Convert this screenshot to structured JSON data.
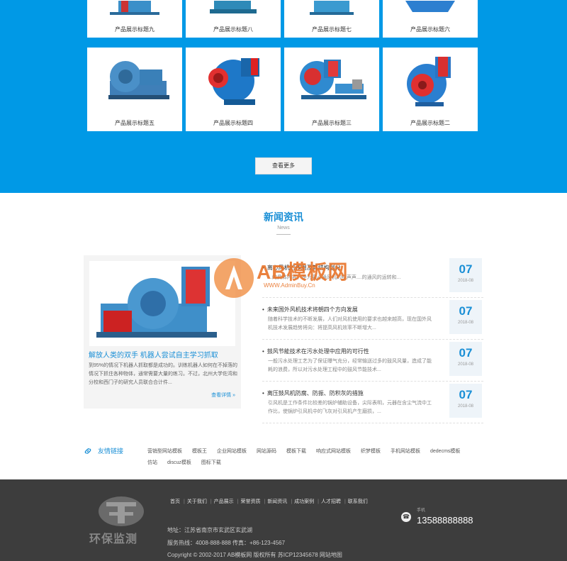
{
  "products": {
    "row1": [
      {
        "title": "产品展示标题九"
      },
      {
        "title": "产品展示标题八"
      },
      {
        "title": "产品展示标题七"
      },
      {
        "title": "产品展示标题六"
      }
    ],
    "row2": [
      {
        "title": "产品展示标题五"
      },
      {
        "title": "产品展示标题四"
      },
      {
        "title": "产品展示标题三"
      },
      {
        "title": "产品展示标题二"
      }
    ],
    "more_label": "查看更多",
    "bg_color": "#0099e6"
  },
  "news": {
    "title": "新闻资讯",
    "subtitle": "News",
    "featured": {
      "title": "解放人类的双手 机器人尝试自主学习抓取",
      "desc": "到95%的情况下机器人抓取都是成功的。训练机器人如何在不掉落的情况下抓住各种物体，通常需要大量的练习。不过，北州大学佐湾和分校和西门子的研究人员联合合计件...",
      "more": "查看详情 »"
    },
    "items": [
      {
        "title": "离心风机的作用及其结构划分",
        "desc": "...的具体内容，是为离心通风机的噪声声....的通风的运转和...",
        "day": "07",
        "ym": "2018-08"
      },
      {
        "title": "未来国外风机技术将朝四个方向发展",
        "desc": "随着科学技术的不断发展，人们对风机使用的要求也越来越高，现在国外风机技术发展趋势将向：将提高风机效率不断增大...",
        "day": "07",
        "ym": "2018-08"
      },
      {
        "title": "鼓风节能技术在污水处理中应用的可行性",
        "desc": "一般污水处理工艺为了保证曝气充分，经常输送过多的鼓风风量，造成了能耗的浪费，所以对污水处理工程中的鼓风节能技术...",
        "day": "07",
        "ym": "2018-08"
      },
      {
        "title": "离压鼓风机防腐、防振、防积灰的措施",
        "desc": "引风机是工作条件比较差的锅炉辅助设备，尖际表明，元器在含尘气流中工作比，使锅炉引风机中的飞灰对引风机产生磨损，...",
        "day": "07",
        "ym": "2018-08"
      }
    ]
  },
  "watermark": {
    "text": "AB模板网",
    "url": "WWW.AdminBuy.Cn"
  },
  "links": {
    "title": "友情链接",
    "row1": [
      "营销型网站模板",
      "模板王",
      "企业网站模板",
      "网站源码",
      "模板下载",
      "响应式网站模板",
      "织梦模板",
      "手机网站模板",
      "dedecms模板"
    ],
    "row2": [
      "仿站",
      "discuz模板",
      "图标下载"
    ]
  },
  "footer": {
    "logo_text": "环保监测",
    "nav": [
      "首页",
      "关于我们",
      "产品展示",
      "荣誉资质",
      "新闻资讯",
      "成功案例",
      "人才招聘",
      "联系我们"
    ],
    "address": "地址：江苏省南京市玄武区玄武湖",
    "service": "服务热线：4008-888-888 传真：+86-123-4567",
    "copyright": "Copyright © 2002-2017 AB模板网 版权所有   苏ICP12345678   网站地图",
    "phone_label": "手机",
    "phone": "13588888888"
  }
}
